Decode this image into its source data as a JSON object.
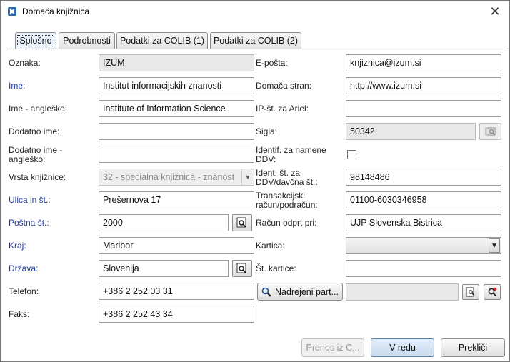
{
  "window": {
    "title": "Domača knjižnica",
    "close_icon": "close-icon"
  },
  "tabs": [
    "Splošno",
    "Podrobnosti",
    "Podatki za COLIB (1)",
    "Podatki za COLIB (2)"
  ],
  "left": {
    "oznaka": {
      "label": "Oznaka:",
      "value": "IZUM"
    },
    "ime": {
      "label": "Ime:",
      "value": "Institut informacijskih znanosti"
    },
    "ime_ang": {
      "label": "Ime - angleško:",
      "value": "Institute of Information Science"
    },
    "dodatno": {
      "label": "Dodatno ime:",
      "value": ""
    },
    "dodatno_ang": {
      "label": "Dodatno ime - angleško:",
      "value": ""
    },
    "vrsta": {
      "label": "Vrsta knjižnice:",
      "value": "32  -  specialna knjižnica - znanost"
    },
    "ulica": {
      "label": "Ulica in št.:",
      "value": "Prešernova 17"
    },
    "posta": {
      "label": "Poštna št.:",
      "value": "2000"
    },
    "kraj": {
      "label": "Kraj:",
      "value": "Maribor"
    },
    "drzava": {
      "label": "Država:",
      "value": "Slovenija"
    },
    "telefon": {
      "label": "Telefon:",
      "value": "+386 2 252 03 31"
    },
    "faks": {
      "label": "Faks:",
      "value": "+386 2 252 43 34"
    }
  },
  "right": {
    "eposta": {
      "label": "E-pošta:",
      "value": "knjiznica@izum.si"
    },
    "domaca": {
      "label": "Domača stran:",
      "value": "http://www.izum.si"
    },
    "ip": {
      "label": "IP-št. za Ariel:",
      "value": ""
    },
    "sigla": {
      "label": "Sigla:",
      "value": "50342"
    },
    "ddv_ident": {
      "label": "Identif. za namene DDV:",
      "checked": false
    },
    "ident_st": {
      "label": "Ident. št. za DDV/davčna št.:",
      "value": "98148486"
    },
    "trans": {
      "label": "Transakcijski račun/podračun:",
      "value": "01100-6030346958"
    },
    "racun": {
      "label": "Račun odprt pri:",
      "value": "UJP Slovenska Bistrica"
    },
    "kartica": {
      "label": "Kartica:",
      "value": ""
    },
    "st_kartice": {
      "label": "Št. kartice:",
      "value": ""
    },
    "nadrejeni": {
      "label": "Nadrejeni part...",
      "value": ""
    }
  },
  "buttons": {
    "prenos": "Prenos iz C...",
    "ok": "V redu",
    "cancel": "Prekliči"
  },
  "colors": {
    "blue_label": "#1f3ba8",
    "accent": "#5a7fa8"
  }
}
